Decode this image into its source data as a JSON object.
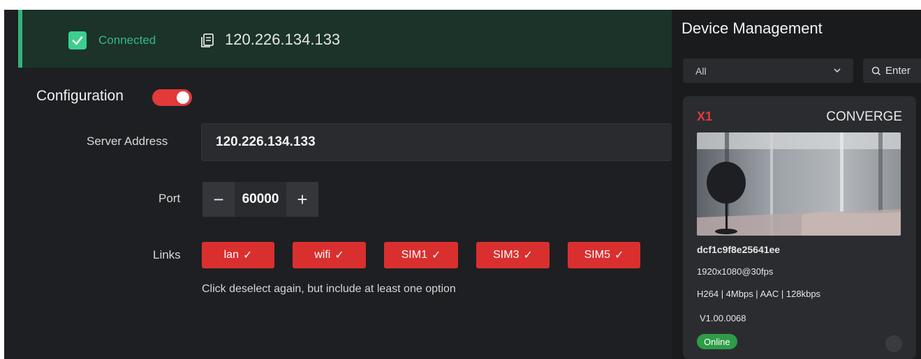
{
  "status": {
    "label": "Connected",
    "ip": "120.226.134.133"
  },
  "config": {
    "title": "Configuration",
    "enabled": true,
    "server_label": "Server Address",
    "server_value": "120.226.134.133",
    "port_label": "Port",
    "port_value": "60000",
    "port_minus": "−",
    "port_plus": "+",
    "links_label": "Links",
    "links": [
      {
        "label": "lan",
        "selected": true
      },
      {
        "label": "wifi",
        "selected": true
      },
      {
        "label": "SIM1",
        "selected": true
      },
      {
        "label": "SIM3",
        "selected": true
      },
      {
        "label": "SIM5",
        "selected": true
      }
    ],
    "check_glyph": "✓",
    "hint": "Click deselect again, but include at least one option"
  },
  "devices": {
    "title": "Device Management",
    "filter": "All",
    "search_placeholder": "Enter",
    "card": {
      "name": "X1",
      "brand": "CONVERGE",
      "id": "dcf1c9f8e25641ee",
      "resolution": "1920x1080@30fps",
      "codec": "H264 | 4Mbps | AAC | 128kbps",
      "version": "V1.00.0068",
      "status": "Online"
    }
  },
  "colors": {
    "accent_red": "#d9302f",
    "connected_green": "#37b983",
    "online_green": "#2e9c47"
  }
}
